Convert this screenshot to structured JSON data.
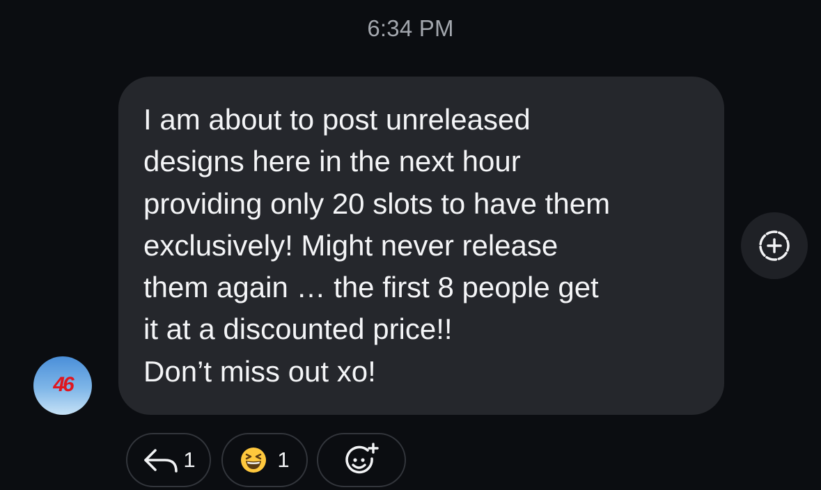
{
  "timestamp": "6:34 PM",
  "sender": {
    "avatar_text": "46"
  },
  "message": {
    "lines": [
      "I am about to post unreleased",
      "designs here in the next hour",
      "providing only 20 slots to have them",
      "exclusively! Might never release",
      "them again … the first 8 people get",
      "it at a discounted price!!",
      "Don’t miss out xo!"
    ]
  },
  "actions": {
    "add_icon": "dashed-circle-plus-icon"
  },
  "reactions": {
    "reply": {
      "icon": "reply-arrow-icon",
      "count": "1"
    },
    "emoji": {
      "icon": "grinning-squinting-face-emoji",
      "count": "1"
    },
    "add": {
      "icon": "add-reaction-smiley-icon"
    }
  },
  "colors": {
    "background": "#0b0d11",
    "bubble": "#25272c",
    "timestamp": "#a3a7ae",
    "avatar_text": "#e0161f"
  }
}
